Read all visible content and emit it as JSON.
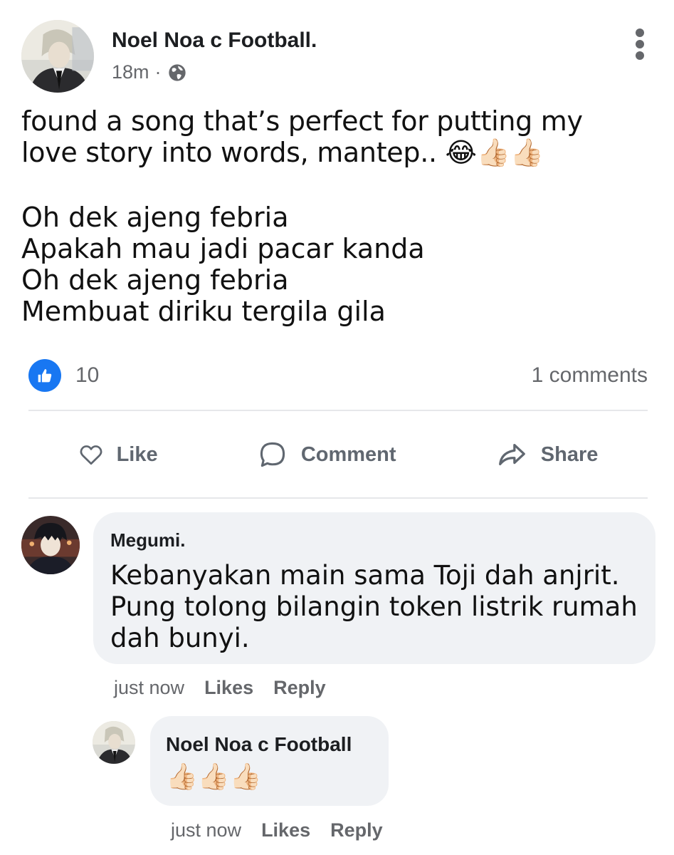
{
  "post": {
    "author": "Noel Noa c Football.",
    "time": "18m",
    "separator": "·",
    "text": "found a song that’s perfect for putting my\nlove story into words, mantep.. 😂👍🏻👍🏻",
    "lyrics": [
      "Oh dek ajeng febria",
      "Apakah mau jadi pacar kanda",
      "Oh dek ajeng febria",
      "Membuat diriku tergila gila"
    ],
    "likes": "10",
    "comments_count": "1 comments"
  },
  "actions": {
    "like": "Like",
    "comment": "Comment",
    "share": "Share"
  },
  "comments": [
    {
      "author": "Megumi.",
      "text": "Kebanyakan main sama Toji dah anjrit. Pung tolong bilangin token listrik rumah dah bunyi.",
      "time": "just now",
      "likes_label": "Likes",
      "reply_label": "Reply"
    },
    {
      "author": "Noel Noa c Football",
      "text": "👍🏻👍🏻👍🏻",
      "time": "just now",
      "likes_label": "Likes",
      "reply_label": "Reply"
    }
  ],
  "icons": {
    "more": "more-options-icon",
    "audience": "globe-icon",
    "like_badge": "thumbs-up-icon",
    "like": "heart-icon",
    "comment": "speech-bubble-icon",
    "share": "share-arrow-icon"
  },
  "colors": {
    "accent": "#1877f2",
    "secondary_text": "#65676b",
    "bubble": "#f0f2f5"
  }
}
